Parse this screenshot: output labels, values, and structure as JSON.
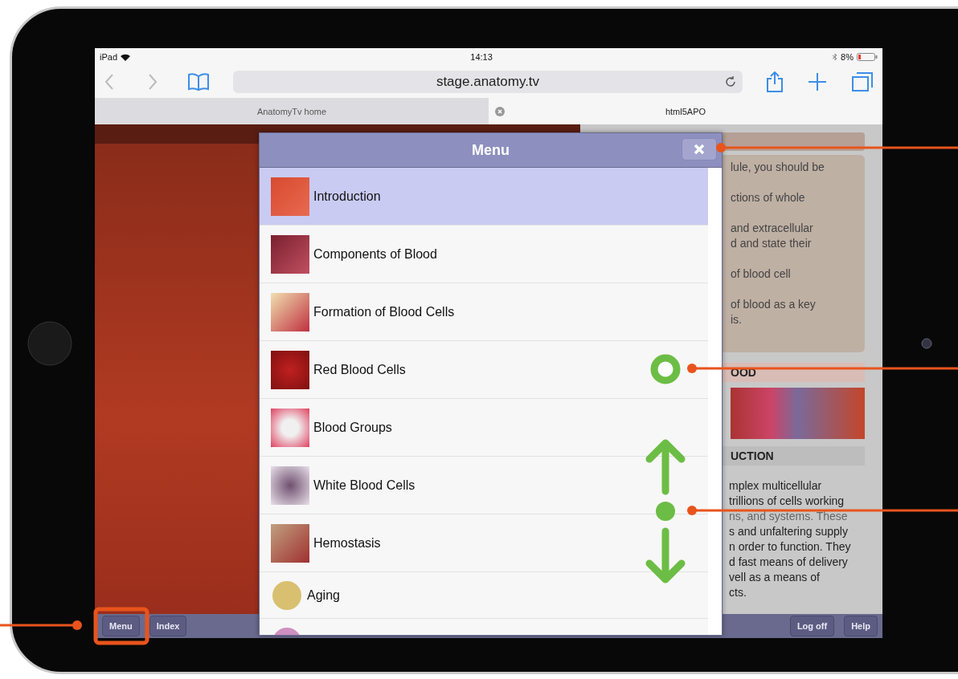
{
  "status_bar": {
    "device": "iPad",
    "time": "14:13",
    "battery": "8%"
  },
  "browser": {
    "url": "stage.anatomy.tv",
    "tabs": [
      {
        "label": "AnatomyTv home",
        "selected": false
      },
      {
        "label": "html5APO",
        "selected": true
      }
    ]
  },
  "side_panel": {
    "objectives": [
      "lule, you should be",
      "ctions of whole",
      "and extracellular\nd and state their",
      "of blood cell",
      "of blood as a key\nis."
    ],
    "section_1": "OOD",
    "section_2": "UCTION",
    "paragraph": [
      "mplex multicellular",
      "trillions of cells working",
      "ns, and systems. These",
      "s and unfaltering supply",
      "n order to function. They",
      "d fast means of delivery",
      "vell as a means of",
      "cts."
    ]
  },
  "menu": {
    "title": "Menu",
    "items": [
      {
        "label": "Introduction",
        "kind": "photo",
        "selected": true
      },
      {
        "label": "Components of Blood",
        "kind": "photo",
        "selected": false
      },
      {
        "label": "Formation of Blood Cells",
        "kind": "photo",
        "selected": false
      },
      {
        "label": "Red Blood Cells",
        "kind": "photo",
        "selected": false
      },
      {
        "label": "Blood Groups",
        "kind": "photo",
        "selected": false
      },
      {
        "label": "White Blood Cells",
        "kind": "photo",
        "selected": false
      },
      {
        "label": "Hemostasis",
        "kind": "photo",
        "selected": false
      },
      {
        "label": "Aging",
        "kind": "circle",
        "selected": false
      },
      {
        "kind": "circle",
        "selected": false
      }
    ]
  },
  "toolbar": {
    "left": [
      "Menu",
      "Index"
    ],
    "right": [
      "Log off",
      "Help"
    ]
  }
}
